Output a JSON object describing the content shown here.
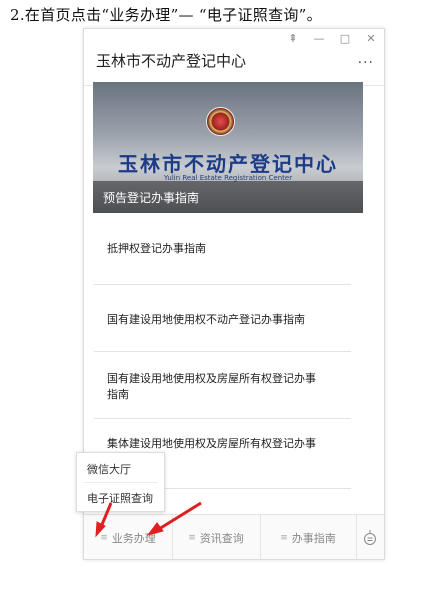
{
  "caption": "2.在首页点击“业务办理”— “电子证照查询”。",
  "window_controls": {
    "pin": "⇞",
    "minimize": "—",
    "maximize": "□",
    "close": "✕"
  },
  "app": {
    "title": "玉林市不动产登记中心",
    "more": "···"
  },
  "banner": {
    "title_cn": "玉林市不动产登记中心",
    "title_en": "Yulin Real Estate Registration Center",
    "caption": "预告登记办事指南"
  },
  "list": [
    "抵押权登记办事指南",
    "国有建设用地使用权不动产登记办事指南",
    "国有建设用地使用权及房屋所有权登记办事指南",
    "集体建设用地使用权及房屋所有权登记办事"
  ],
  "tabs": [
    {
      "label": "业务办理",
      "icon": "≡"
    },
    {
      "label": "资讯查询",
      "icon": "≡"
    },
    {
      "label": "办事指南",
      "icon": "≡"
    }
  ],
  "popup": {
    "items": [
      "微信大厅",
      "电子证照查询"
    ]
  },
  "colors": {
    "arrow": "#e02020",
    "banner_text": "#1d3c88"
  }
}
